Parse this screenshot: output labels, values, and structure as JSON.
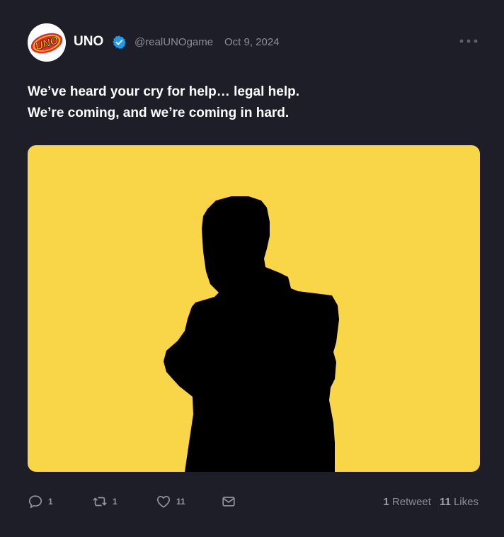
{
  "account": {
    "name": "UNO",
    "handle": "@realUNOgame",
    "date": "Oct 9, 2024",
    "logo_text": "UNO",
    "verified": true
  },
  "tweet": {
    "lines": [
      "We’ve heard your cry for help… legal help.",
      "We’re coming, and we’re coming in hard."
    ]
  },
  "media": {
    "background_color": "#f9d648",
    "subject": "black silhouette of a man with arms crossed"
  },
  "actions": {
    "reply_count": "1",
    "retweet_count": "1",
    "like_count": "11"
  },
  "stats": {
    "retweets_value": "1",
    "retweets_label": "Retweet",
    "likes_value": "11",
    "likes_label": "Likes"
  },
  "colors": {
    "background": "#1d1e27",
    "text": "#ffffff",
    "muted": "#8b8e99",
    "verified": "#1d9bf0",
    "logo_red": "#e8262c",
    "logo_yellow": "#f7d21c"
  },
  "icons": [
    "verified-badge-icon",
    "more-options-icon",
    "reply-icon",
    "retweet-icon",
    "like-icon",
    "share-mail-icon"
  ]
}
